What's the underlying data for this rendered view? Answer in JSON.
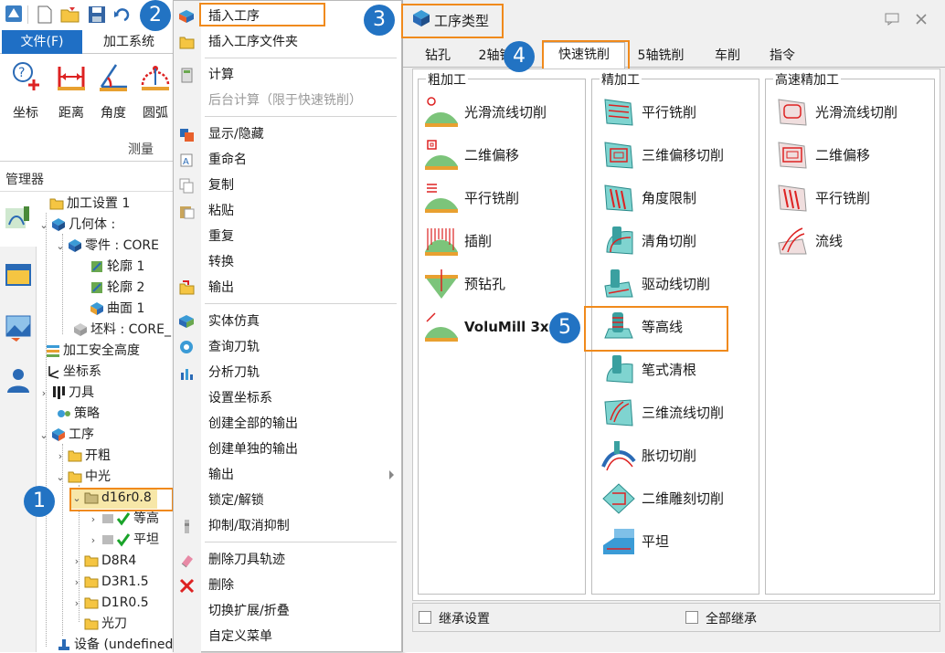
{
  "app": {
    "ribbon_tabs": [
      "文件(F)",
      "加工系统"
    ],
    "ribbon_buttons": [
      "坐标",
      "距离",
      "角度",
      "圆弧"
    ],
    "ribbon_group": "测量",
    "manager_title": "管理器"
  },
  "tree": [
    {
      "label": "加工设置 1"
    },
    {
      "label": "几何体 :"
    },
    {
      "label": "零件 : CORE"
    },
    {
      "label": "轮廓 1"
    },
    {
      "label": "轮廓 2"
    },
    {
      "label": "曲面 1"
    },
    {
      "label": "坯料 : CORE_"
    },
    {
      "label": "加工安全高度"
    },
    {
      "label": "坐标系"
    },
    {
      "label": "刀具"
    },
    {
      "label": "策略"
    },
    {
      "label": "工序"
    },
    {
      "label": "开粗"
    },
    {
      "label": "中光"
    },
    {
      "label": "d16r0.8"
    },
    {
      "label": "等高"
    },
    {
      "label": "平坦"
    },
    {
      "label": "D8R4"
    },
    {
      "label": "D3R1.5"
    },
    {
      "label": "D1R0.5"
    },
    {
      "label": "光刀"
    },
    {
      "label": "设备 (undefined"
    }
  ],
  "context_menu": {
    "items": [
      {
        "label": "插入工序"
      },
      {
        "label": "插入工序文件夹"
      },
      {
        "label": "计算"
      },
      {
        "label": "后台计算（限于快速铣削）"
      },
      {
        "label": "显示/隐藏"
      },
      {
        "label": "重命名"
      },
      {
        "label": "复制"
      },
      {
        "label": "粘贴"
      },
      {
        "label": "重复"
      },
      {
        "label": "转换"
      },
      {
        "label": "输出"
      },
      {
        "label": "实体仿真"
      },
      {
        "label": "查询刀轨"
      },
      {
        "label": "分析刀轨"
      },
      {
        "label": "设置坐标系"
      },
      {
        "label": "创建全部的输出"
      },
      {
        "label": "创建单独的输出"
      },
      {
        "label": "输出"
      },
      {
        "label": "锁定/解锁"
      },
      {
        "label": "抑制/取消抑制"
      },
      {
        "label": "删除刀具轨迹"
      },
      {
        "label": "删除"
      },
      {
        "label": "切换扩展/折叠"
      },
      {
        "label": "自定义菜单"
      }
    ]
  },
  "dialog": {
    "title": "工序类型",
    "tabs": [
      "钻孔",
      "2轴铣",
      "快速铣削",
      "5轴铣削",
      "车削",
      "指令"
    ],
    "active_tab": "快速铣削",
    "groups": [
      {
        "title": "粗加工",
        "ops": [
          "光滑流线切削",
          "二维偏移",
          "平行铣削",
          "插削",
          "预钻孔",
          "VoluMill 3x"
        ]
      },
      {
        "title": "精加工",
        "ops": [
          "平行铣削",
          "三维偏移切削",
          "角度限制",
          "清角切削",
          "驱动线切削",
          "等高线",
          "笔式清根",
          "三维流线切削",
          "胀切切削",
          "二维雕刻切削",
          "平坦"
        ]
      },
      {
        "title": "高速精加工",
        "ops": [
          "光滑流线切削",
          "二维偏移",
          "平行铣削",
          "流线"
        ]
      }
    ],
    "footer": {
      "inherit_settings": "继承设置",
      "inherit_all": "全部继承"
    }
  },
  "callouts": [
    "1",
    "2",
    "3",
    "4",
    "5"
  ],
  "colors": {
    "accent_blue": "#1f6fc5",
    "highlight_orange": "#f08a1c",
    "badge_blue": "#2273c3"
  }
}
